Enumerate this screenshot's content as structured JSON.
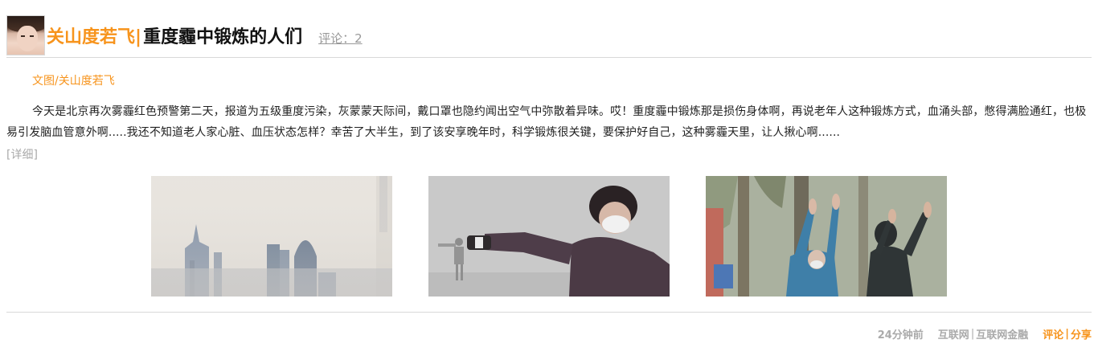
{
  "header": {
    "author": "关山度若飞",
    "separator": "|",
    "title": "重度霾中锻炼的人们",
    "comment_link": "评论：2"
  },
  "byline": "文图/关山度若飞",
  "body": {
    "text": "今天是北京再次雾霾红色预警第二天，报道为五级重度污染，灰蒙蒙天际间，戴口罩也隐约闻出空气中弥散着异味。哎！重度霾中锻炼那是损伤身体啊，再说老年人这种锻炼方式，血涌头部，憋得满脸通红，也极易引发脑血管意外啊.....我还不知道老人家心脏、血压状态怎样？幸苦了大半生，到了该安享晚年时，科学锻炼很关键，要保护好自己，这种雾霾天里，让人揪心啊......",
    "detail_link": "[详细]"
  },
  "photos": [
    {
      "name": "smoggy-city-skyline-photo"
    },
    {
      "name": "masked-woman-exercising-photo"
    },
    {
      "name": "elderly-women-raising-arms-photo"
    }
  ],
  "footer": {
    "time_ago": "24分钟前",
    "tags": [
      "互联网",
      "互联网金融"
    ],
    "tag_separator": "|",
    "actions": [
      "评论",
      "分享"
    ],
    "action_separator": "|"
  },
  "colors": {
    "accent": "#f7941d",
    "muted": "#999999",
    "rule": "#d9d9d9"
  }
}
